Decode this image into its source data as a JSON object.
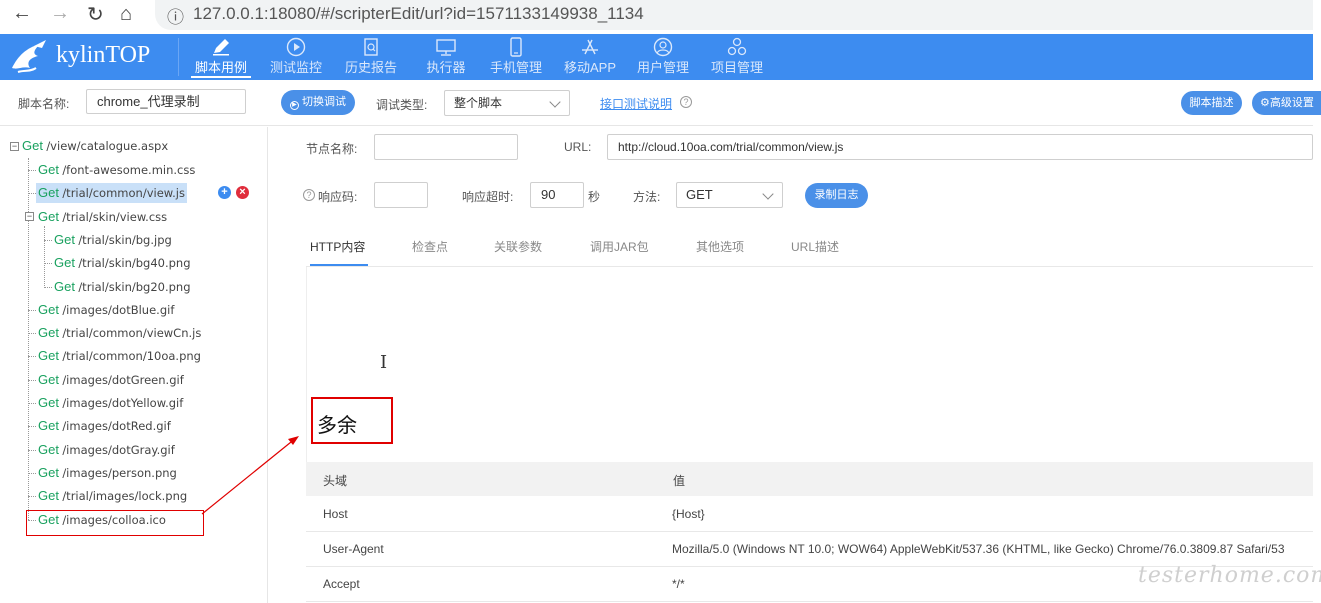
{
  "browser": {
    "url": "127.0.0.1:18080/#/scripterEdit/url?id=1571133149938_1134"
  },
  "app": {
    "brand": "kylinTOP",
    "menu": [
      {
        "label": "脚本用例",
        "icon": "pencil-icon"
      },
      {
        "label": "测试监控",
        "icon": "play-icon"
      },
      {
        "label": "历史报告",
        "icon": "report-icon"
      },
      {
        "label": "执行器",
        "icon": "monitor-icon"
      },
      {
        "label": "手机管理",
        "icon": "phone-icon"
      },
      {
        "label": "移动APP",
        "icon": "appstore-icon"
      },
      {
        "label": "用户管理",
        "icon": "user-icon"
      },
      {
        "label": "项目管理",
        "icon": "project-icon"
      }
    ]
  },
  "toolbar": {
    "script_name_label": "脚本名称:",
    "script_name_value": "chrome_代理录制",
    "switch_debug": "切换调试",
    "debug_type_label": "调试类型:",
    "debug_type_value": "整个脚本",
    "api_help_link": "接口测试说明",
    "script_desc": "脚本描述",
    "advanced_settings": "高级设置"
  },
  "tree": {
    "root": {
      "method": "Get",
      "path": "/view/catalogue.aspx"
    },
    "nodes": [
      {
        "method": "Get",
        "path": "/font-awesome.min.css"
      },
      {
        "method": "Get",
        "path": "/trial/common/view.js"
      },
      {
        "method": "Get",
        "path": "/trial/skin/view.css"
      },
      {
        "method": "Get",
        "path": "/trial/skin/bg.jpg"
      },
      {
        "method": "Get",
        "path": "/trial/skin/bg40.png"
      },
      {
        "method": "Get",
        "path": "/trial/skin/bg20.png"
      },
      {
        "method": "Get",
        "path": "/images/dotBlue.gif"
      },
      {
        "method": "Get",
        "path": "/trial/common/viewCn.js"
      },
      {
        "method": "Get",
        "path": "/trial/common/10oa.png"
      },
      {
        "method": "Get",
        "path": "/images/dotGreen.gif"
      },
      {
        "method": "Get",
        "path": "/images/dotYellow.gif"
      },
      {
        "method": "Get",
        "path": "/images/dotRed.gif"
      },
      {
        "method": "Get",
        "path": "/images/dotGray.gif"
      },
      {
        "method": "Get",
        "path": "/images/person.png"
      },
      {
        "method": "Get",
        "path": "/trial/images/lock.png"
      },
      {
        "method": "Get",
        "path": "/images/colloa.ico"
      }
    ]
  },
  "form": {
    "node_name_label": "节点名称:",
    "node_name_value": "",
    "url_label": "URL:",
    "url_value": "http://cloud.10oa.com/trial/common/view.js",
    "response_code_label": "响应码:",
    "response_code_value": "",
    "timeout_label": "响应超时:",
    "timeout_value": "90",
    "timeout_unit": "秒",
    "method_label": "方法:",
    "method_value": "GET",
    "record_log": "录制日志"
  },
  "tabs": [
    "HTTP内容",
    "检查点",
    "关联参数",
    "调用JAR包",
    "其他选项",
    "URL描述"
  ],
  "annotation": "多余",
  "headers_table": {
    "columns": [
      "头域",
      "值"
    ],
    "rows": [
      [
        "Host",
        "{Host}"
      ],
      [
        "User-Agent",
        "Mozilla/5.0 (Windows NT 10.0; WOW64) AppleWebKit/537.36 (KHTML, like Gecko) Chrome/76.0.3809.87 Safari/53"
      ],
      [
        "Accept",
        "*/*"
      ]
    ]
  },
  "watermark": "testerhome.com",
  "colors": {
    "primary": "#3d8cf0",
    "method_green": "#19a15f",
    "annotation_red": "#e00000"
  }
}
